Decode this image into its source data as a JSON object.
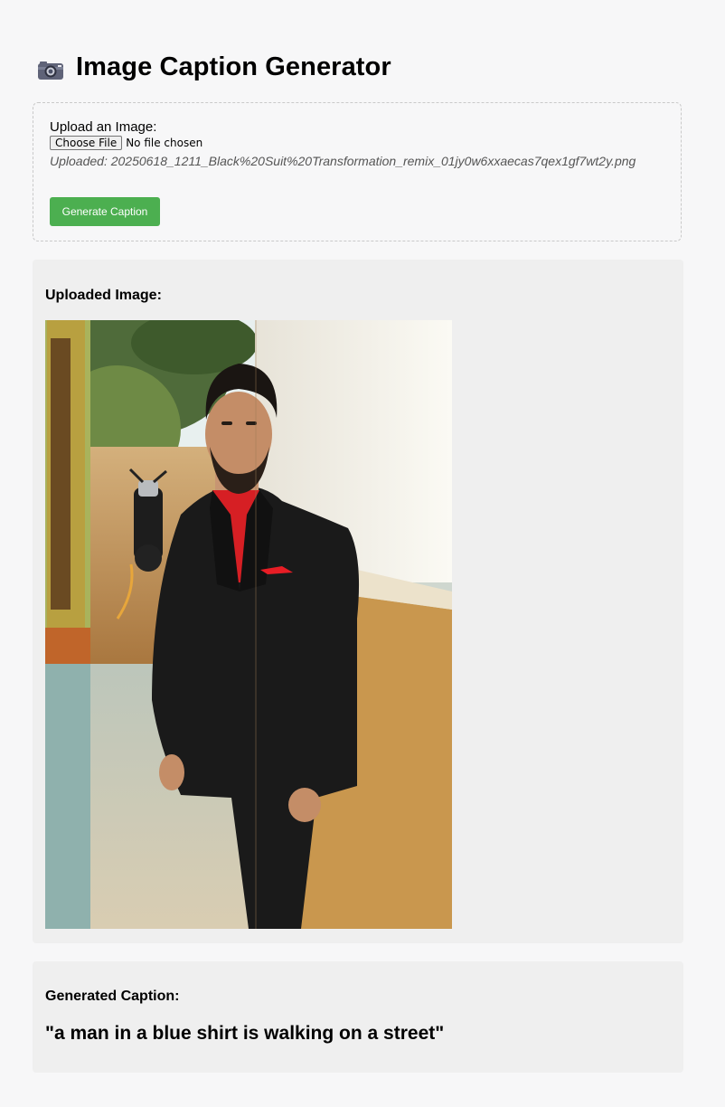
{
  "header": {
    "title": "Image Caption Generator",
    "icon": "camera-icon"
  },
  "upload": {
    "label": "Upload an Image:",
    "choose_button": "Choose File",
    "no_file_text": "No file chosen",
    "uploaded_text": "Uploaded: 20250618_1211_Black%20Suit%20Transformation_remix_01jy0w6xxaecas7qex1gf7wt2y.png",
    "generate_button": "Generate Caption",
    "generate_button_color": "#4caf50"
  },
  "image_panel": {
    "heading": "Uploaded Image:"
  },
  "caption_panel": {
    "heading": "Generated Caption:",
    "caption": "\"a man in a blue shirt is walking on a street\""
  }
}
